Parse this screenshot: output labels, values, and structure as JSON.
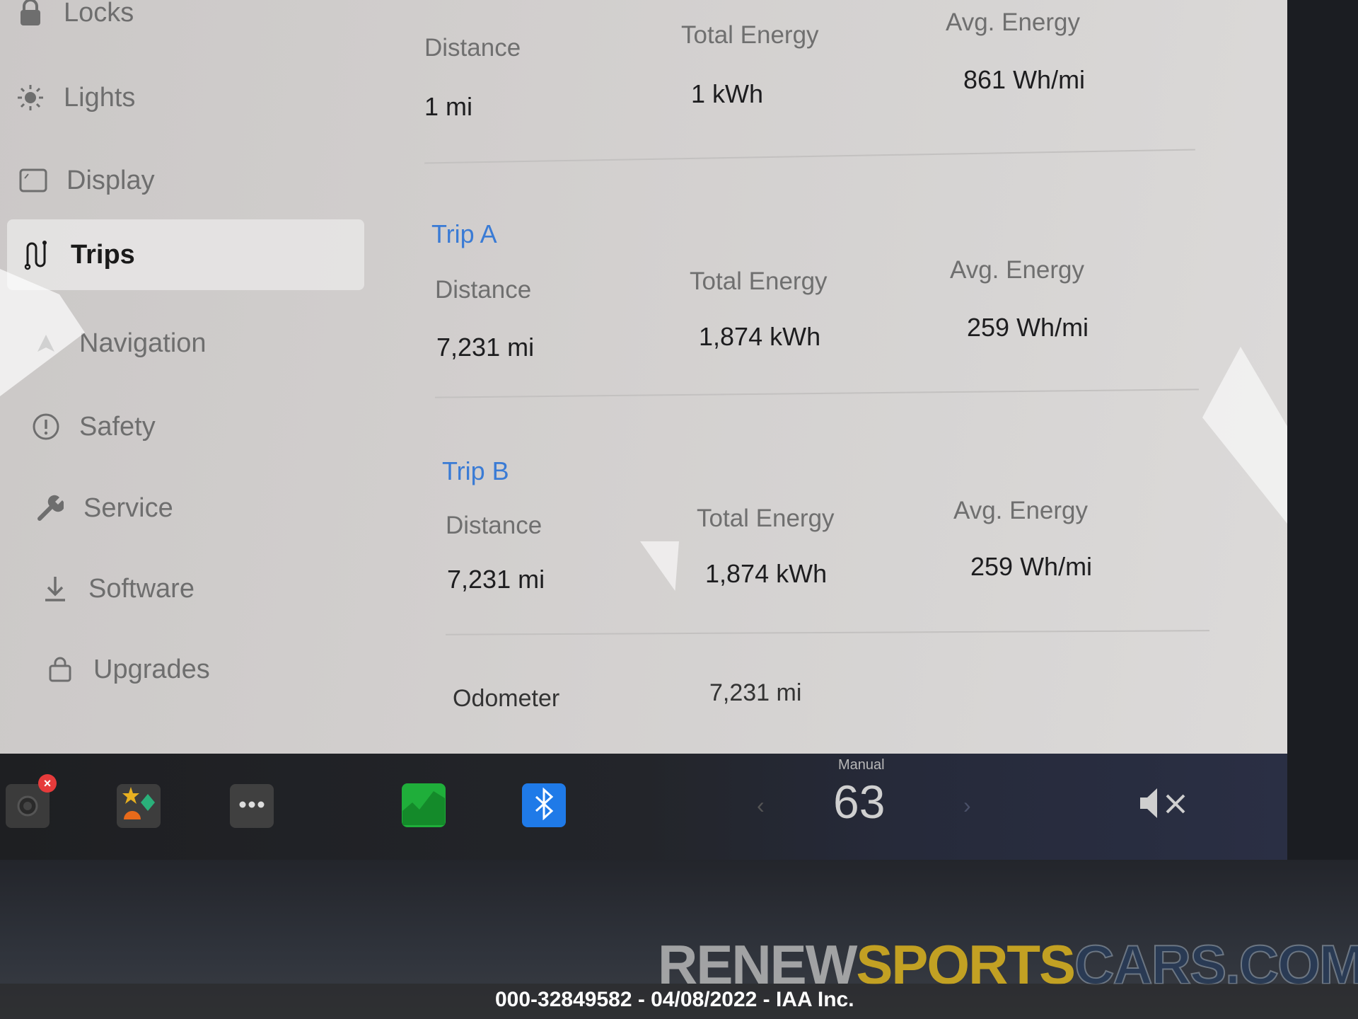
{
  "sidebar": {
    "items": [
      {
        "label": "Locks",
        "icon": "lock-icon"
      },
      {
        "label": "Lights",
        "icon": "sun-icon"
      },
      {
        "label": "Display",
        "icon": "display-icon"
      },
      {
        "label": "Trips",
        "icon": "trips-icon",
        "active": true
      },
      {
        "label": "Navigation",
        "icon": "navigation-icon"
      },
      {
        "label": "Safety",
        "icon": "alert-circle-icon"
      },
      {
        "label": "Service",
        "icon": "wrench-icon"
      },
      {
        "label": "Software",
        "icon": "download-icon"
      },
      {
        "label": "Upgrades",
        "icon": "shopping-bag-icon"
      }
    ]
  },
  "trips": {
    "since_last": {
      "distance_label": "Distance",
      "distance": "1 mi",
      "energy_label": "Total Energy",
      "energy": "1 kWh",
      "avg_label": "Avg. Energy",
      "avg": "861 Wh/mi"
    },
    "trip_a": {
      "title": "Trip A",
      "distance_label": "Distance",
      "distance": "7,231 mi",
      "energy_label": "Total Energy",
      "energy": "1,874 kWh",
      "avg_label": "Avg. Energy",
      "avg": "259 Wh/mi"
    },
    "trip_b": {
      "title": "Trip B",
      "distance_label": "Distance",
      "distance": "7,231 mi",
      "energy_label": "Total Energy",
      "energy": "1,874 kWh",
      "avg_label": "Avg. Energy",
      "avg": "259 Wh/mi"
    },
    "odometer": {
      "label": "Odometer",
      "value": "7,231 mi"
    }
  },
  "taskbar": {
    "icons": [
      "camera-icon",
      "toybox-icon",
      "more-apps-icon",
      "energy-app-icon",
      "bluetooth-icon"
    ],
    "climate": {
      "mode": "Manual",
      "temperature": "63"
    },
    "volume": "muted"
  },
  "colors": {
    "accent": "#3a7bd5",
    "energy_app": "#1fae3a",
    "bluetooth": "#1f7ae8",
    "alert_badge": "#e63b3b"
  },
  "watermark": {
    "part1": "RENEW",
    "part2": "SPORTS",
    "part3": "CARS.COM"
  },
  "caption": "000-32849582 - 04/08/2022 - IAA Inc."
}
